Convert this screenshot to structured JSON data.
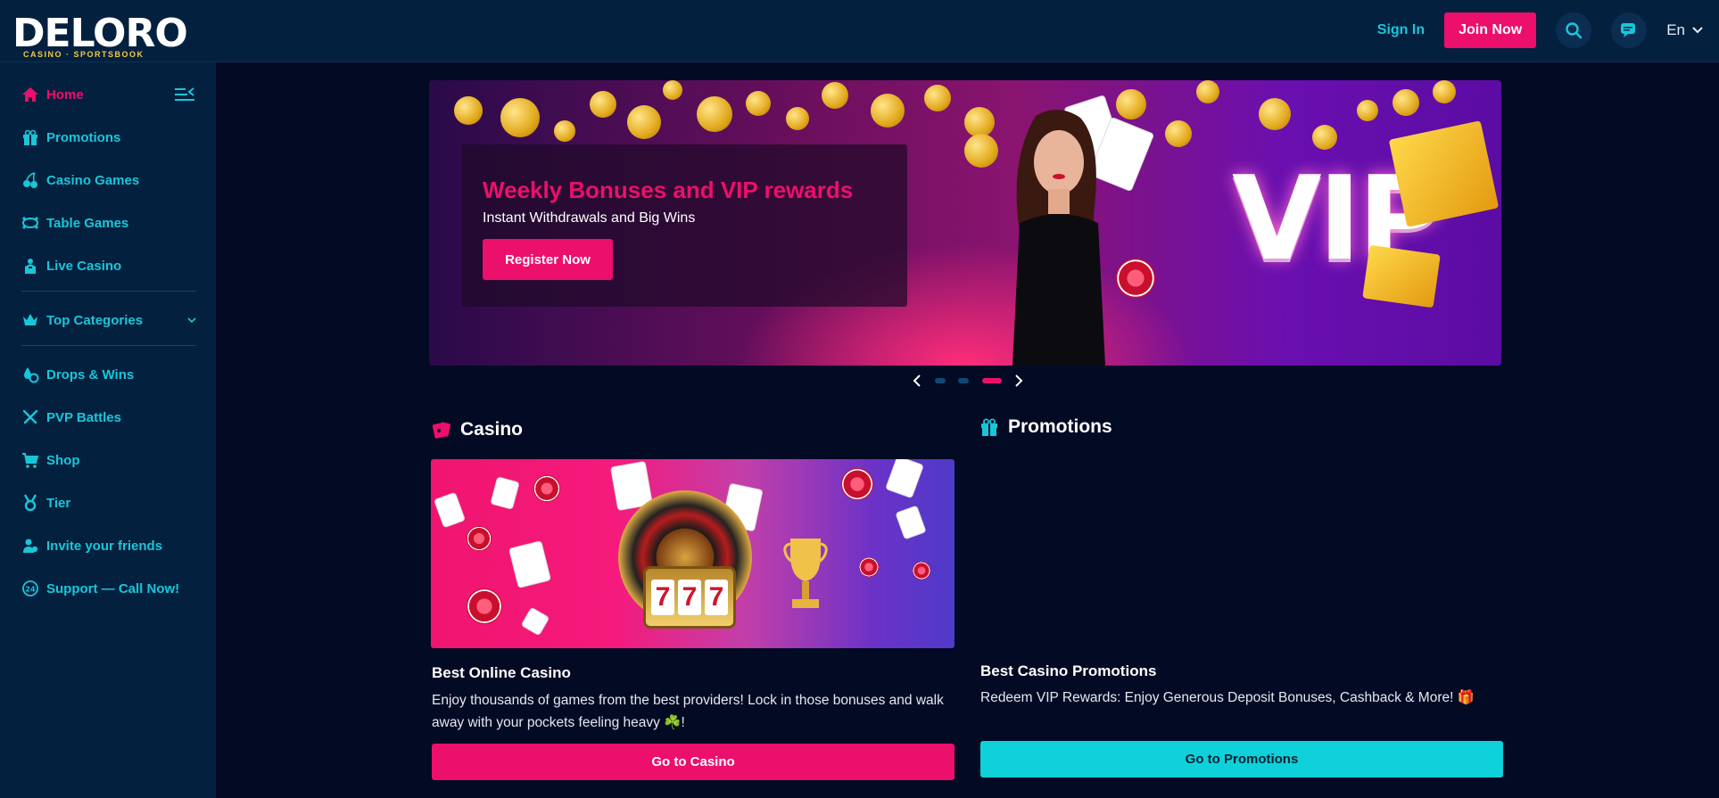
{
  "brand": {
    "logo_text": "DELORO",
    "logo_tagline": "CASINO · SPORTSBOOK"
  },
  "header": {
    "signin_label": "Sign In",
    "join_label": "Join Now",
    "language": "En",
    "icons": [
      "search-icon",
      "chat-icon",
      "chevron-down-icon"
    ]
  },
  "sidebar": {
    "items": [
      {
        "label": "Home",
        "icon": "home-icon",
        "active": true
      },
      {
        "label": "Promotions",
        "icon": "gift-icon"
      },
      {
        "label": "Casino Games",
        "icon": "cherry-icon"
      },
      {
        "label": "Table Games",
        "icon": "table-icon"
      },
      {
        "label": "Live Casino",
        "icon": "dealer-icon"
      },
      {
        "label": "Top Categories",
        "icon": "crown-icon",
        "expandable": true
      },
      {
        "label": "Drops & Wins",
        "icon": "drops-icon"
      },
      {
        "label": "PVP Battles",
        "icon": "swords-icon"
      },
      {
        "label": "Shop",
        "icon": "cart-icon"
      },
      {
        "label": "Tier",
        "icon": "medal-icon"
      },
      {
        "label": "Invite your friends",
        "icon": "users-icon"
      },
      {
        "label": "Support — Call Now!",
        "icon": "support-icon"
      }
    ]
  },
  "banner": {
    "title": "Weekly Bonuses and VIP rewards",
    "subtitle": "Instant Withdrawals and Big Wins",
    "cta_label": "Register Now",
    "vip_text": "VIP",
    "slides_total": 3,
    "active_slide": 3
  },
  "casino": {
    "section_title": "Casino",
    "heading": "Best Online Casino",
    "text": "Enjoy thousands of games from the best providers! Lock in those bonuses and walk away with your pockets feeling heavy ☘️!",
    "cta_label": "Go to Casino",
    "slot_digits": [
      "7",
      "7",
      "7"
    ]
  },
  "promotions": {
    "section_title": "Promotions",
    "heading": "Best Casino Promotions",
    "text": "Redeem VIP Rewards: Enjoy Generous Deposit Bonuses, Cashback & More! 🎁",
    "cta_label": "Go to Promotions"
  },
  "colors": {
    "accent_pink": "#ec0f6b",
    "accent_cyan": "#19c6d9",
    "panel": "#03213f",
    "background": "#030a24"
  }
}
